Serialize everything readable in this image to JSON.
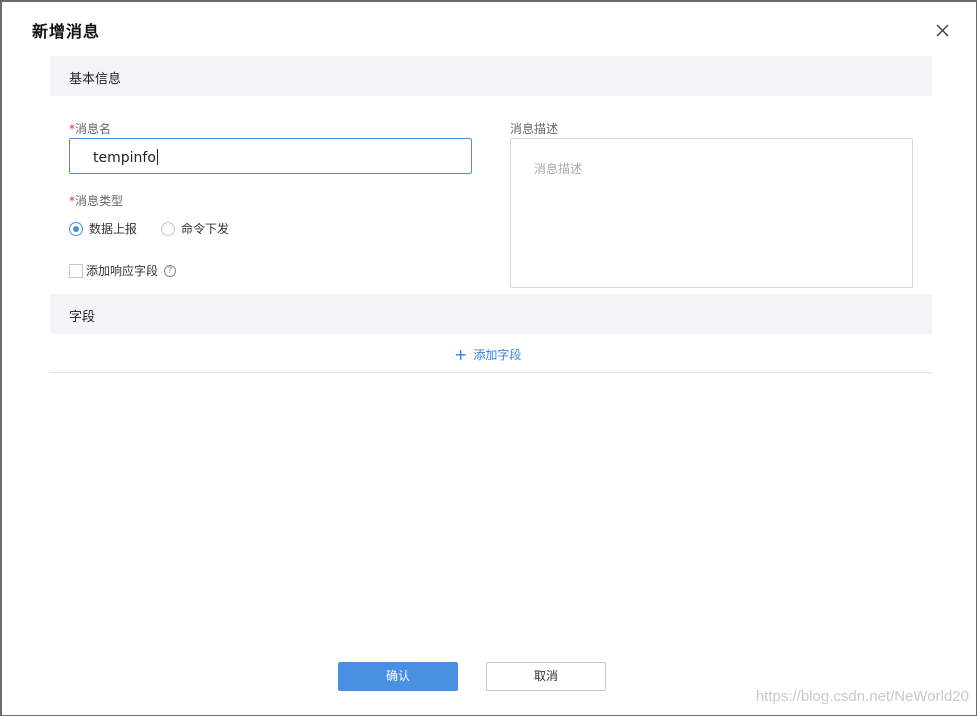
{
  "dialog": {
    "title": "新增消息"
  },
  "basic_section": {
    "title": "基本信息"
  },
  "name_field": {
    "required_mark": "*",
    "label": "消息名",
    "value": "tempinfo"
  },
  "type_field": {
    "required_mark": "*",
    "label": "消息类型",
    "options": [
      "数据上报",
      "命令下发"
    ],
    "selected": "数据上报"
  },
  "response_checkbox": {
    "label": "添加响应字段",
    "checked": false,
    "help_icon": "?"
  },
  "desc_field": {
    "label": "消息描述",
    "placeholder": "消息描述"
  },
  "fields_section": {
    "title": "字段",
    "add_label": "添加字段",
    "add_icon": "+"
  },
  "buttons": {
    "confirm": "确认",
    "cancel": "取消"
  },
  "watermark": "https://blog.csdn.net/NeWorld20",
  "colors": {
    "accent": "#4a90e2",
    "required": "#e4393c",
    "section_bg": "#f2f5f8",
    "link": "#3a82d6"
  }
}
